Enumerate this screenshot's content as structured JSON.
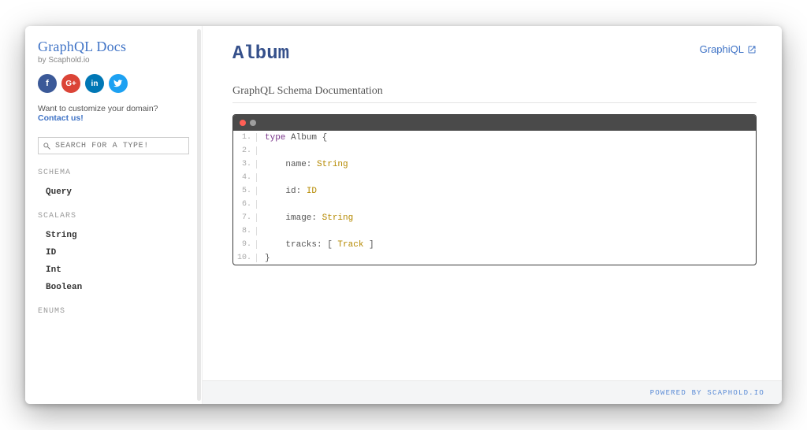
{
  "sidebar": {
    "title": "GraphQL Docs",
    "subtitle": "by Scaphold.io",
    "customize_prefix": "Want to customize your domain? ",
    "customize_link": "Contact us!",
    "search_placeholder": "SEARCH FOR A TYPE!",
    "sections": {
      "schema": {
        "label": "SCHEMA",
        "items": [
          "Query"
        ]
      },
      "scalars": {
        "label": "SCALARS",
        "items": [
          "String",
          "ID",
          "Int",
          "Boolean"
        ]
      },
      "enums": {
        "label": "ENUMS"
      }
    },
    "icons": {
      "fb": "f",
      "gp": "G+",
      "in": "in",
      "tw": ""
    }
  },
  "main": {
    "type_title": "Album",
    "graphiql_label": "GraphiQL",
    "section_label": "GraphQL Schema Documentation"
  },
  "code": {
    "lines": [
      {
        "n": "1.",
        "segments": [
          {
            "t": "type ",
            "c": "kw"
          },
          {
            "t": "Album {",
            "c": "fn"
          }
        ]
      },
      {
        "n": "2.",
        "segments": []
      },
      {
        "n": "3.",
        "segments": [
          {
            "t": "    name: ",
            "c": "fn"
          },
          {
            "t": "String",
            "c": "ty"
          }
        ]
      },
      {
        "n": "4.",
        "segments": []
      },
      {
        "n": "5.",
        "segments": [
          {
            "t": "    id: ",
            "c": "fn"
          },
          {
            "t": "ID",
            "c": "ty"
          }
        ]
      },
      {
        "n": "6.",
        "segments": []
      },
      {
        "n": "7.",
        "segments": [
          {
            "t": "    image: ",
            "c": "fn"
          },
          {
            "t": "String",
            "c": "ty"
          }
        ]
      },
      {
        "n": "8.",
        "segments": []
      },
      {
        "n": "9.",
        "segments": [
          {
            "t": "    tracks: [ ",
            "c": "fn"
          },
          {
            "t": "Track",
            "c": "ty"
          },
          {
            "t": " ]",
            "c": "fn"
          }
        ]
      },
      {
        "n": "10.",
        "segments": [
          {
            "t": "}",
            "c": "fn"
          }
        ]
      }
    ]
  },
  "footer": {
    "text": "POWERED BY SCAPHOLD.IO"
  }
}
